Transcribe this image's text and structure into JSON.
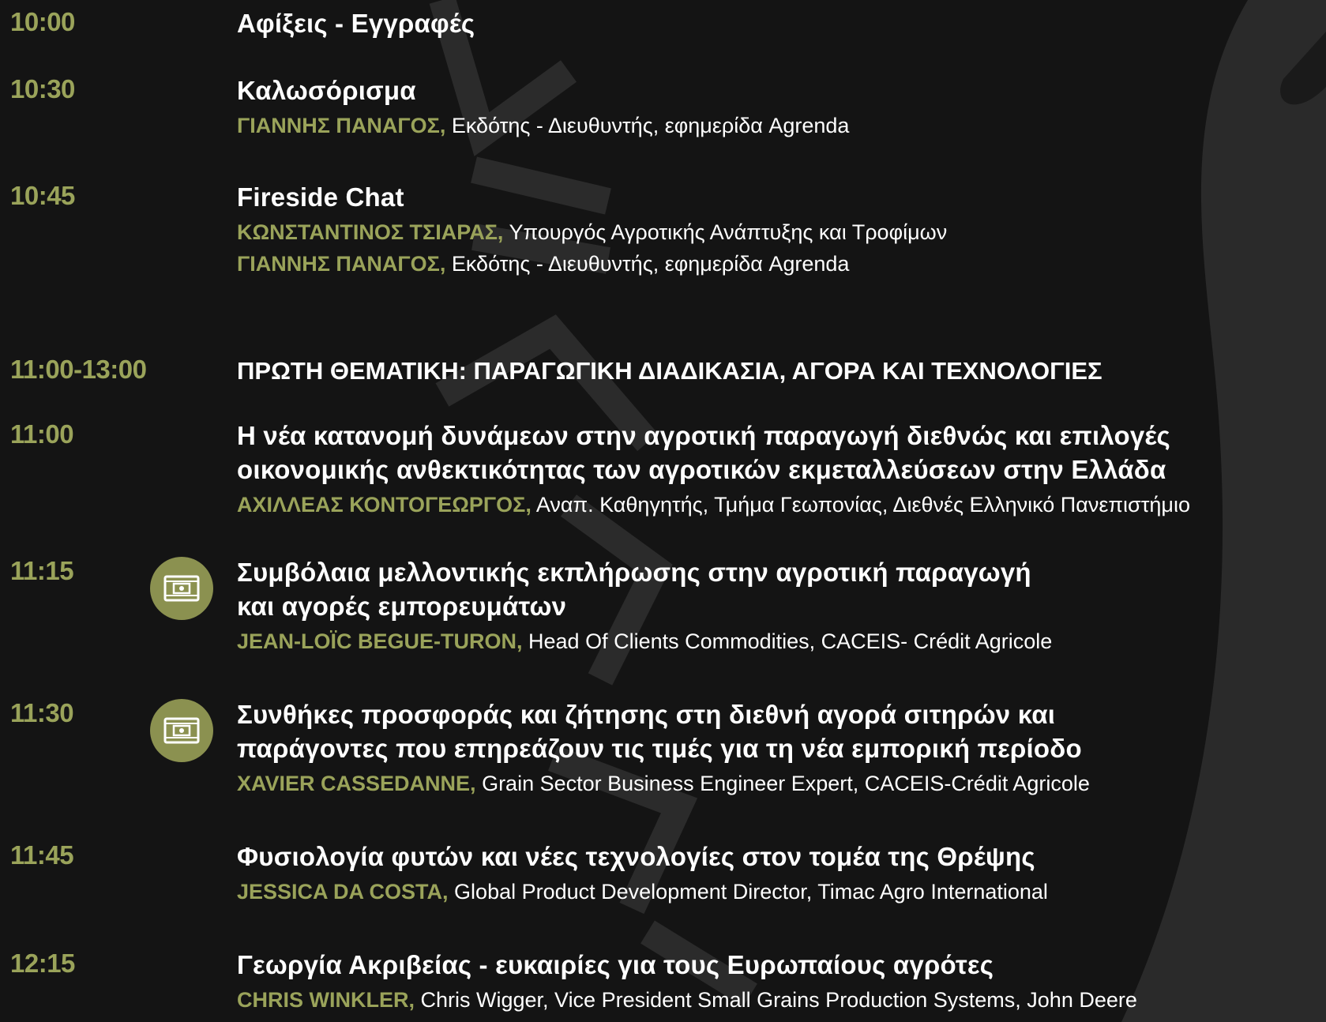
{
  "colors": {
    "background": "#141414",
    "accent": "#9aa35a",
    "icon_bg": "#8b9150",
    "text": "#ffffff"
  },
  "agenda": [
    {
      "time": "10:00",
      "title": "Αφίξεις - Εγγραφές",
      "speakers": []
    },
    {
      "time": "10:30",
      "title": "Καλωσόρισμα",
      "speakers": [
        {
          "name": "ΓΙΑΝΝΗΣ ΠΑΝΑΓΟΣ,",
          "role": " Εκδότης - Διευθυντής, εφημερίδα Agrenda"
        }
      ]
    },
    {
      "time": "10:45",
      "title": "Fireside Chat",
      "speakers": [
        {
          "name": "ΚΩΝΣΤΑΝΤΙΝΟΣ ΤΣΙΑΡΑΣ,",
          "role": " Υπουργός Αγροτικής Ανάπτυξης και Τροφίμων"
        },
        {
          "name": "ΓΙΑΝΝΗΣ ΠΑΝΑΓΟΣ,",
          "role": " Εκδότης - Διευθυντής, εφημερίδα Agrenda"
        }
      ]
    },
    {
      "time": "11:00-13:00",
      "title": "ΠΡΩΤΗ ΘΕΜΑΤΙΚΗ: ΠΑΡΑΓΩΓΙΚΗ ΔΙΑΔΙΚΑΣΙΑ, ΑΓΟΡΑ ΚΑΙ ΤΕΧΝΟΛΟΓΙΕΣ",
      "speakers": []
    },
    {
      "time": "11:00",
      "title_lines": [
        "Η νέα κατανομή δυνάμεων στην αγροτική παραγωγή διεθνώς και επιλογές",
        "οικονομικής ανθεκτικότητας των αγροτικών εκμεταλλεύσεων στην Ελλάδα"
      ],
      "speakers": [
        {
          "name": "ΑΧΙΛΛΕΑΣ ΚΟΝΤΟΓΕΩΡΓΟΣ,",
          "role": " Αναπ. Καθηγητής, Τμήμα Γεωπονίας, Διεθνές Ελληνικό Πανεπιστήμιο"
        }
      ]
    },
    {
      "time": "11:15",
      "icon": "video-icon",
      "title_lines": [
        "Συμβόλαια μελλοντικής εκπλήρωσης στην αγροτική παραγωγή",
        "και αγορές εμπορευμάτων"
      ],
      "speakers": [
        {
          "name": "JEAN-LOÏC BEGUE-TURON,",
          "role": " Head Of Clients Commodities, CACEIS- Crédit Agricole"
        }
      ]
    },
    {
      "time": "11:30",
      "icon": "video-icon",
      "title_lines": [
        "Συνθήκες προσφοράς και ζήτησης στη διεθνή αγορά σιτηρών και",
        "παράγοντες που επηρεάζουν τις τιμές για τη νέα εμπορική περίοδο"
      ],
      "speakers": [
        {
          "name": "XAVIER CASSEDANNE,",
          "role": " Grain Sector Business Engineer Expert, CACEIS-Crédit Agricole"
        }
      ]
    },
    {
      "time": "11:45",
      "title": "Φυσιολογία φυτών και νέες τεχνολογίες στον τομέα της Θρέψης",
      "speakers": [
        {
          "name": "JESSICA DA COSTA,",
          "role": " Global Product Development Director, Timac Agro International"
        }
      ]
    },
    {
      "time": "12:15",
      "title": "Γεωργία Ακριβείας - ευκαιρίες για τους Ευρωπαίους αγρότες",
      "speakers": [
        {
          "name": "CHRIS WINKLER,",
          "role": " Chris Wigger, Vice President Small Grains Production Systems, John Deere"
        }
      ]
    }
  ]
}
